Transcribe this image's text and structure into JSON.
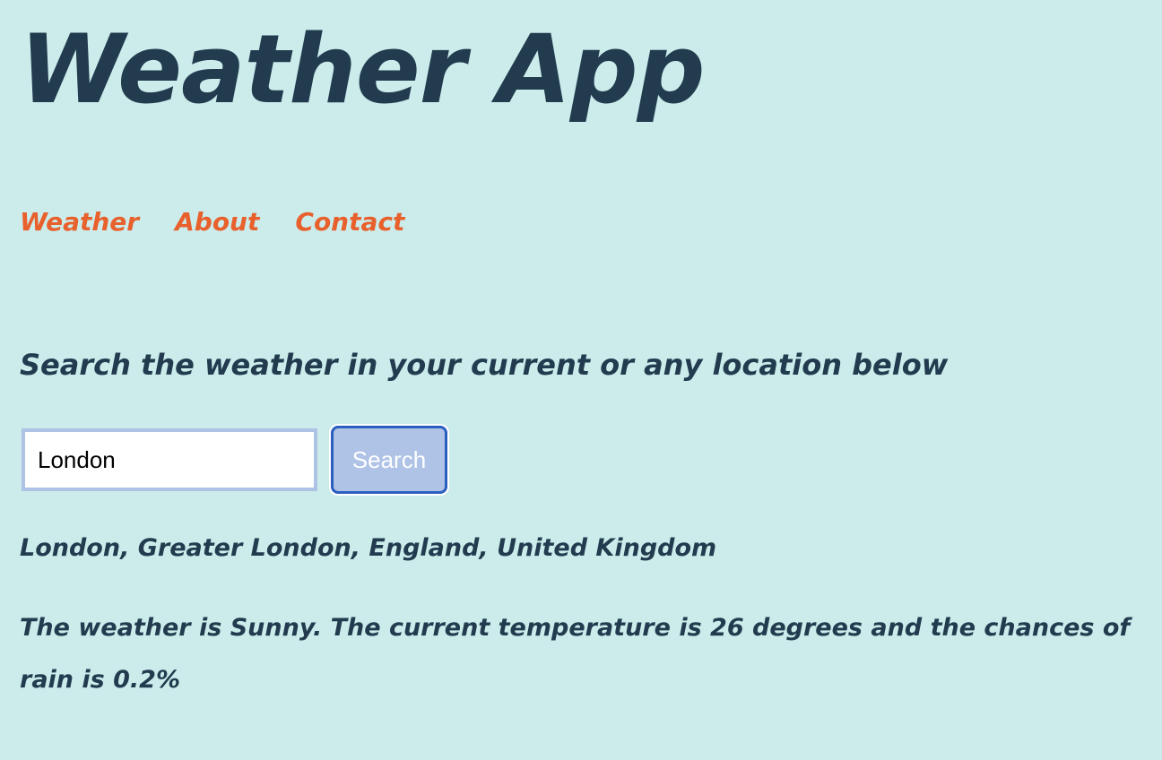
{
  "header": {
    "title": "Weather App"
  },
  "nav": {
    "items": [
      {
        "label": "Weather"
      },
      {
        "label": "About"
      },
      {
        "label": "Contact"
      }
    ]
  },
  "search": {
    "heading": "Search the weather in your current or any location below",
    "input_value": "London",
    "button_label": "Search"
  },
  "result": {
    "location": "London, Greater London, England, United Kingdom",
    "description": "The weather is Sunny. The current temperature is 26 degrees and the chances of rain is 0.2%"
  },
  "colors": {
    "background": "#cbeceb",
    "text": "#223b4f",
    "nav_link": "#e8602c",
    "button_bg": "#afc3e6",
    "button_border": "#2a5fc0",
    "input_border": "#aec2e4"
  }
}
